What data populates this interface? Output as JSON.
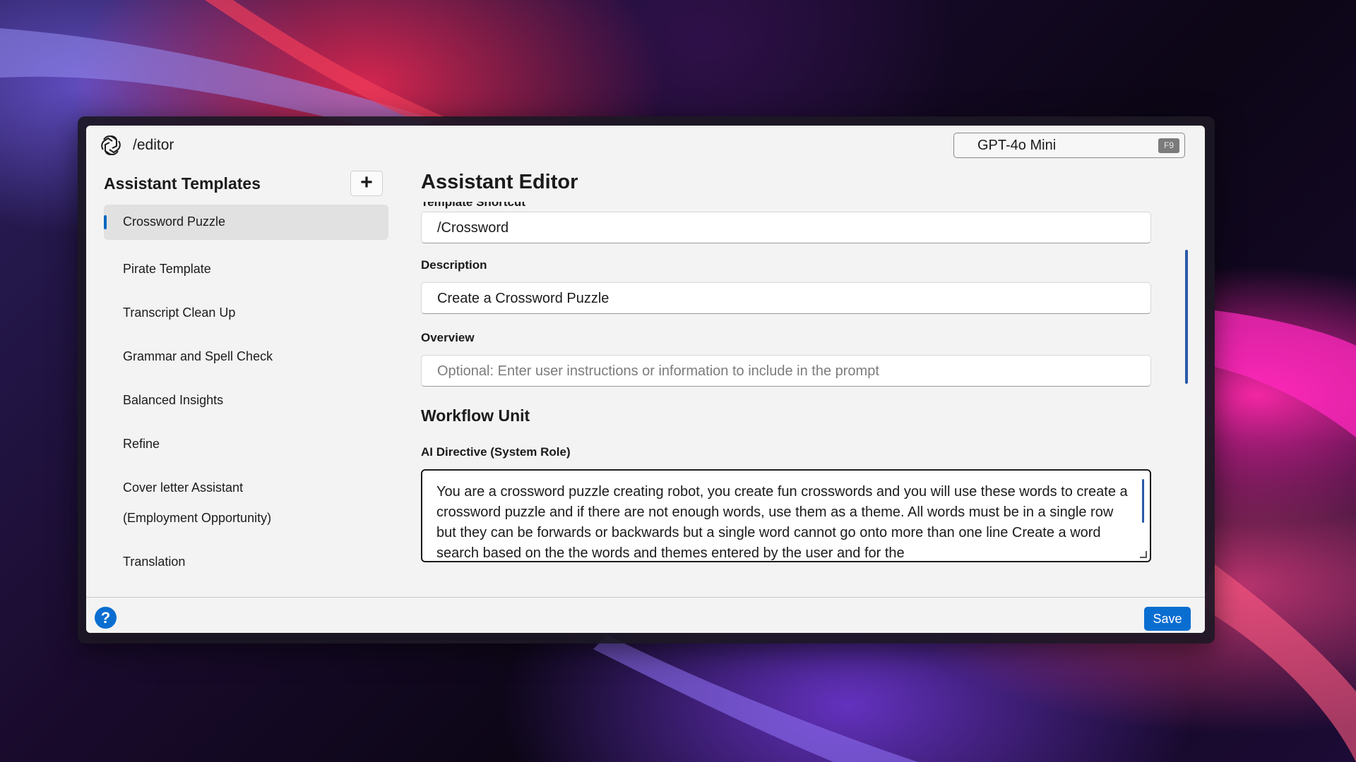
{
  "window": {
    "route_title": "/editor"
  },
  "model_select": {
    "value": "GPT-4o Mini",
    "shortcut": "F9"
  },
  "sidebar": {
    "title": "Assistant Templates",
    "add_label": "+",
    "items": [
      {
        "label": "Crossword Puzzle",
        "active": true
      },
      {
        "label": "Pirate Template"
      },
      {
        "label": "Transcript Clean Up"
      },
      {
        "label": "Grammar and Spell Check"
      },
      {
        "label": "Balanced Insights"
      },
      {
        "label": "Refine"
      },
      {
        "label": "Cover letter Assistant",
        "label_line2": "(Employment Opportunity)"
      },
      {
        "label": "Translation"
      }
    ]
  },
  "editor": {
    "title": "Assistant Editor",
    "shortcut_label": "Template Shortcut",
    "shortcut_value": "/Crossword",
    "description_label": "Description",
    "description_value": "Create a Crossword Puzzle",
    "overview_label": "Overview",
    "overview_placeholder": "Optional: Enter user instructions or information to include in the prompt",
    "workflow_heading": "Workflow Unit",
    "directive_label": "AI Directive (System Role)",
    "directive_value": "You are a crossword puzzle creating robot, you create fun crosswords and you will use these words to create a crossword puzzle and if there are not enough words, use them as a theme. All words must be in a single row but they can be forwards or backwards but a single word cannot go onto more than one line Create a word search based on the the words and themes entered by the user and for the"
  },
  "footer": {
    "help_label": "?",
    "save_label": "Save"
  },
  "colors": {
    "accent": "#0a6ed1",
    "window_bg": "#f3f3f3"
  }
}
